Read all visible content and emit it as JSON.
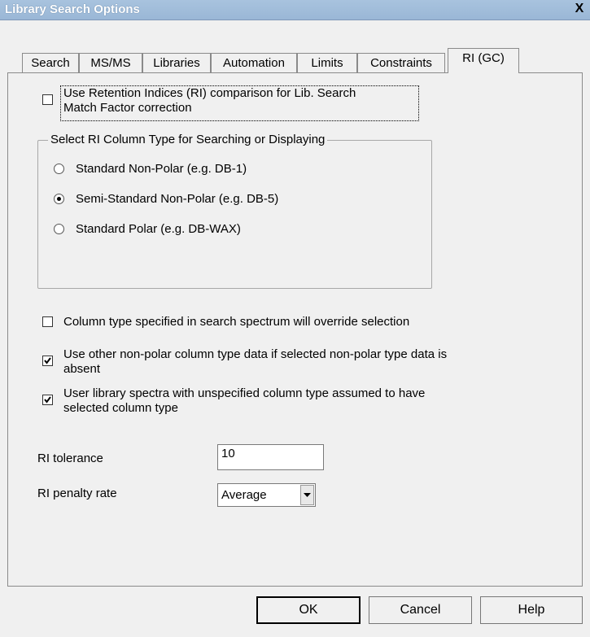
{
  "window": {
    "title": "Library Search Options",
    "close_glyph": "X"
  },
  "tabs": [
    {
      "label": "Search"
    },
    {
      "label": "MS/MS"
    },
    {
      "label": "Libraries"
    },
    {
      "label": "Automation"
    },
    {
      "label": "Limits"
    },
    {
      "label": "Constraints"
    },
    {
      "label": "RI (GC)",
      "active": true
    }
  ],
  "ri": {
    "use_ri_label_line1": "Use Retention Indices (RI) comparison for Lib. Search",
    "use_ri_label_line2": "Match Factor correction",
    "use_ri_checked": false,
    "group_title": "Select RI Column Type for Searching or Displaying",
    "column_types": [
      {
        "label": "Standard Non-Polar (e.g. DB-1)",
        "selected": false
      },
      {
        "label": "Semi-Standard Non-Polar (e.g. DB-5)",
        "selected": true
      },
      {
        "label": "Standard Polar (e.g. DB-WAX)",
        "selected": false
      }
    ],
    "override_label": "Column type specified in search spectrum will override selection",
    "override_checked": false,
    "other_nonpolar_line1": "Use other non-polar column type data if selected non-polar type data is",
    "other_nonpolar_line2": "absent",
    "other_nonpolar_checked": true,
    "user_lib_line1": "User library spectra with unspecified column type assumed to have",
    "user_lib_line2": "selected column type",
    "user_lib_checked": true,
    "tolerance_label": "RI tolerance",
    "tolerance_value": "10",
    "penalty_label": "RI penalty rate",
    "penalty_value": "Average"
  },
  "buttons": {
    "ok": "OK",
    "cancel": "Cancel",
    "help": "Help"
  }
}
